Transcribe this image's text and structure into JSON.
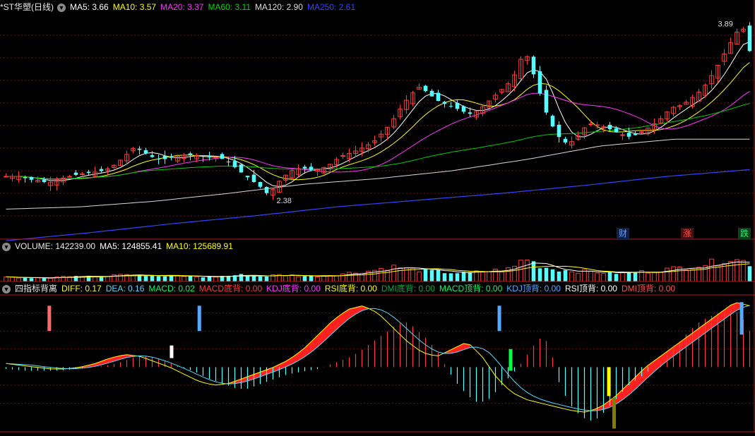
{
  "colors": {
    "background": "#000000",
    "grid": "#7a1010",
    "up": "#ff3b3b",
    "down": "#54ffff",
    "ma5": "#ffffff",
    "ma10": "#ffff00",
    "ma20": "#ff33ff",
    "ma60": "#00cc00",
    "ma120": "#d8d8d8",
    "ma250": "#3344ff"
  },
  "main": {
    "title": "*ST华塑(日线)",
    "toggle_icon": "chevron-down-icon",
    "ma": [
      {
        "label": "MA5: 3.66",
        "color": "#ffffff"
      },
      {
        "label": "MA10: 3.57",
        "color": "#ffff00"
      },
      {
        "label": "MA20: 3.37",
        "color": "#ff33ff"
      },
      {
        "label": "MA60: 3.11",
        "color": "#00dd00"
      },
      {
        "label": "MA120: 2.90",
        "color": "#dddddd"
      },
      {
        "label": "MA250: 2.61",
        "color": "#3344ff"
      }
    ],
    "tags": [
      {
        "label": "财",
        "color": "#5aa0ff",
        "bg": "#10204a"
      },
      {
        "label": "涨",
        "color": "#ff5050",
        "bg": "#4a1010"
      },
      {
        "label": "跌",
        "color": "#00ff66",
        "bg": "#10401a"
      }
    ]
  },
  "volume_panel": {
    "label": "VOLUME: 142239.00",
    "ma5": "MA5: 124855.41",
    "ma10": "MA10: 125689.91"
  },
  "indicator_panel": {
    "title": "四指标背离",
    "items": [
      {
        "label": "DIFF: 0.17",
        "color": "#ffff00"
      },
      {
        "label": "DEA: 0.16",
        "color": "#54d8ff"
      },
      {
        "label": "MACD: 0.02",
        "color": "#00ff66"
      },
      {
        "label": "MACD底背: 0.00",
        "color": "#ff3b3b"
      },
      {
        "label": "KDJ底背: 0.00",
        "color": "#ff33ff"
      },
      {
        "label": "RSI底背: 0.00",
        "color": "#ffff00"
      },
      {
        "label": "DMI底背: 0.00",
        "color": "#00aa44"
      },
      {
        "label": "MACD顶背: 0.00",
        "color": "#00ff66"
      },
      {
        "label": "KDJ顶背: 0.00",
        "color": "#54aaff"
      },
      {
        "label": "RSI顶背: 0.00",
        "color": "#ffffff"
      },
      {
        "label": "DMI顶背: 0.00",
        "color": "#ff5050"
      }
    ]
  },
  "chart_data": {
    "type": "candlestick",
    "y_range": [
      2.0,
      4.0
    ],
    "high_annotation": "3.89",
    "low_annotation": "2.38",
    "anchor_prices": [
      2.55,
      2.55,
      2.55,
      2.52,
      2.52,
      2.5,
      2.5,
      2.53,
      2.54,
      2.56,
      2.57,
      2.58,
      2.59,
      2.6,
      2.63,
      2.68,
      2.74,
      2.8,
      2.78,
      2.74,
      2.7,
      2.7,
      2.72,
      2.73,
      2.74,
      2.74,
      2.73,
      2.72,
      2.72,
      2.7,
      2.66,
      2.6,
      2.55,
      2.5,
      2.45,
      2.38,
      2.48,
      2.55,
      2.6,
      2.62,
      2.62,
      2.6,
      2.62,
      2.65,
      2.7,
      2.74,
      2.76,
      2.79,
      2.82,
      2.86,
      2.93,
      3.0,
      3.1,
      3.2,
      3.28,
      3.34,
      3.3,
      3.24,
      3.2,
      3.18,
      3.15,
      3.12,
      3.1,
      3.14,
      3.2,
      3.26,
      3.32,
      3.38,
      3.48,
      3.68,
      3.5,
      3.3,
      3.1,
      2.96,
      2.86,
      2.84,
      2.9,
      2.98,
      3.02,
      3.0,
      2.98,
      2.95,
      2.92,
      2.9,
      2.92,
      2.96,
      3.0,
      3.05,
      3.12,
      3.17,
      3.18,
      3.23,
      3.28,
      3.35,
      3.45,
      3.56,
      3.68,
      3.8,
      3.89,
      3.66
    ],
    "volume_range": [
      0,
      200000
    ],
    "volume_anchors": [
      30000,
      28000,
      32000,
      26000,
      30000,
      27000,
      25000,
      34000,
      36000,
      30000,
      38000,
      42000,
      40000,
      36000,
      45000,
      60000,
      52000,
      48000,
      44000,
      40000,
      38000,
      36000,
      34000,
      40000,
      36000,
      34000,
      32000,
      30000,
      34000,
      38000,
      42000,
      46000,
      44000,
      40000,
      36000,
      40000,
      44000,
      46000,
      42000,
      40000,
      38000,
      36000,
      40000,
      44000,
      50000,
      55000,
      60000,
      64000,
      70000,
      78000,
      90000,
      98000,
      104000,
      90000,
      84000,
      80000,
      76000,
      70000,
      66000,
      62000,
      60000,
      58000,
      62000,
      66000,
      70000,
      76000,
      80000,
      86000,
      110000,
      170000,
      140000,
      110000,
      96000,
      86000,
      80000,
      76000,
      72000,
      70000,
      68000,
      64000,
      60000,
      58000,
      60000,
      62000,
      64000,
      68000,
      72000,
      78000,
      84000,
      90000,
      96000,
      100000,
      110000,
      120000,
      130000,
      140000,
      160000,
      150000,
      142239,
      125000
    ],
    "macd_range": [
      -0.35,
      0.4
    ],
    "macd_bar_anchors": [
      -0.01,
      -0.015,
      -0.02,
      -0.02,
      -0.02,
      -0.02,
      -0.015,
      -0.01,
      -0.005,
      0.0,
      0.01,
      0.02,
      0.04,
      0.06,
      0.06,
      0.05,
      0.03,
      0.01,
      -0.01,
      -0.03,
      -0.06,
      -0.08,
      -0.1,
      -0.12,
      -0.12,
      -0.1,
      -0.08,
      -0.06,
      -0.04,
      -0.03,
      -0.02,
      -0.01,
      0.01,
      0.03,
      0.05,
      0.08,
      0.12,
      0.16,
      0.2,
      0.24,
      0.25,
      0.2,
      0.15,
      0.08,
      -0.02,
      -0.1,
      -0.16,
      -0.2,
      -0.18,
      -0.12,
      -0.06,
      0.0,
      0.08,
      0.16,
      0.14,
      -0.08,
      -0.2,
      -0.26,
      -0.3,
      -0.28,
      -0.22,
      -0.16,
      -0.1,
      -0.06,
      -0.02,
      0.02,
      0.08,
      0.14,
      0.2,
      0.25,
      0.28,
      0.3,
      0.32,
      0.3,
      0.2
    ],
    "diff_anchors": [
      0.02,
      0.01,
      0.0,
      -0.01,
      -0.01,
      0.0,
      0.02,
      0.05,
      0.07,
      0.06,
      0.03,
      0.0,
      -0.04,
      -0.08,
      -0.1,
      -0.09,
      -0.06,
      -0.03,
      0.0,
      0.04,
      0.1,
      0.18,
      0.26,
      0.32,
      0.34,
      0.3,
      0.22,
      0.14,
      0.08,
      0.06,
      0.1,
      0.14,
      0.06,
      -0.06,
      -0.14,
      -0.18,
      -0.2,
      -0.22,
      -0.24,
      -0.25,
      -0.22,
      -0.16,
      -0.08,
      0.0,
      0.06,
      0.12,
      0.18,
      0.24,
      0.3,
      0.36,
      0.34
    ],
    "divergence_markers": [
      {
        "name": "DMI顶背",
        "at": 0.062,
        "color": "#ff6b6b",
        "from": 0.34,
        "to": 0.2
      },
      {
        "name": "KDJ顶背",
        "at": 0.262,
        "color": "#54aaff",
        "from": 0.34,
        "to": 0.2
      },
      {
        "name": "RSI顶背",
        "at": 0.225,
        "color": "#ffffff",
        "from": 0.12,
        "to": 0.05
      },
      {
        "name": "KDJ顶背",
        "at": 0.662,
        "color": "#54aaff",
        "from": 0.34,
        "to": 0.2
      },
      {
        "name": "MACD顶背",
        "at": 0.677,
        "color": "#00ff44",
        "from": 0.1,
        "to": -0.02
      },
      {
        "name": "RSI底背",
        "at": 0.808,
        "color": "#ffff00",
        "from": 0.0,
        "to": -0.16
      },
      {
        "name": "DMI底背",
        "at": 0.815,
        "color": "#808000",
        "from": -0.17,
        "to": -0.34
      },
      {
        "name": "KDJ顶背",
        "at": 0.985,
        "color": "#54aaff",
        "from": 0.36,
        "to": 0.18
      }
    ]
  }
}
